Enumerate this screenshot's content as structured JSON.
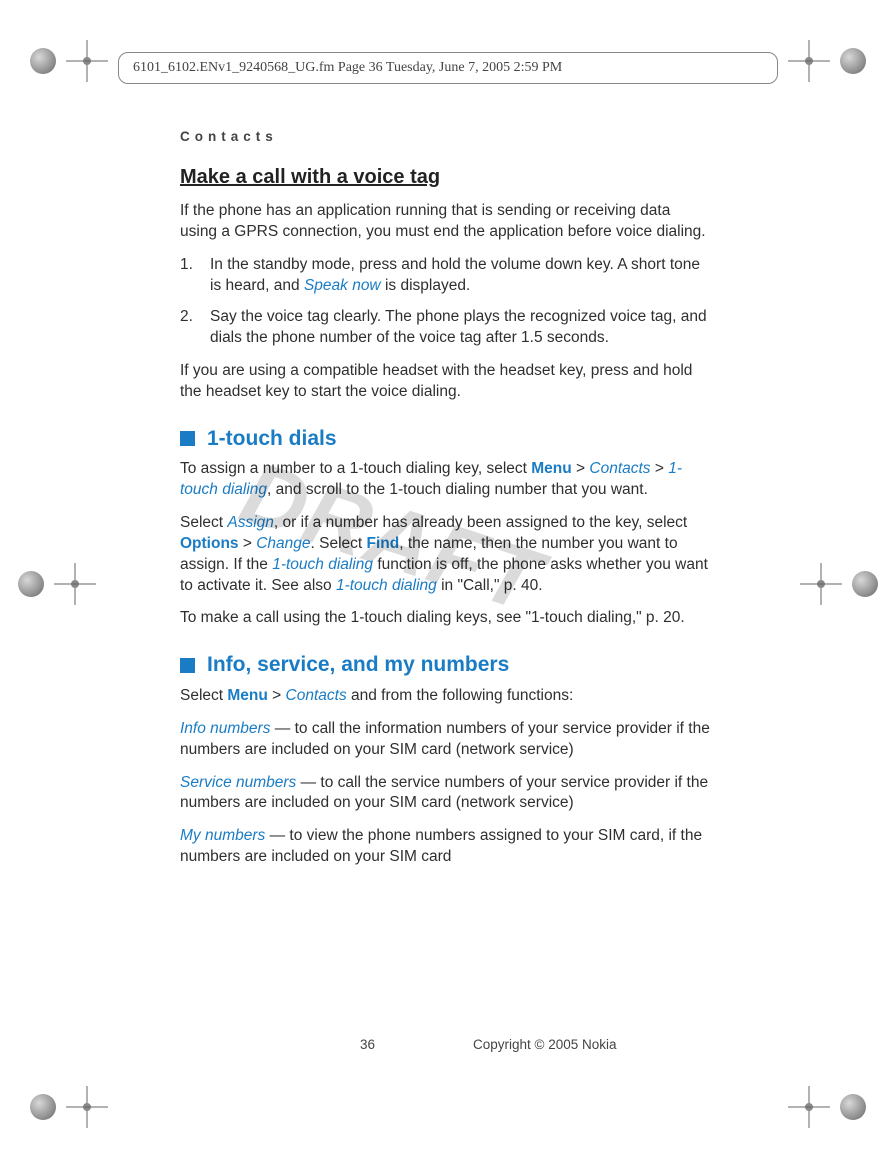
{
  "header_info": "6101_6102.ENv1_9240568_UG.fm  Page 36  Tuesday, June 7, 2005  2:59 PM",
  "running_head": "Contacts",
  "watermark": "DRAFT",
  "h3_voice_tag": "Make a call with a voice tag",
  "p_voice_intro": "If the phone has an application running that is sending or receiving data using a GPRS connection, you must end the application before voice dialing.",
  "li1_num": "1.",
  "li1_a": "In the standby mode, press and hold the volume down key. A short tone is heard, and ",
  "li1_speak": "Speak now",
  "li1_b": " is displayed.",
  "li2_num": "2.",
  "li2_txt": "Say the voice tag clearly. The phone plays the recognized voice tag, and dials the phone number of the voice tag after 1.5 seconds.",
  "p_headset": "If you are using a compatible headset with the headset key, press and hold the headset key to start the voice dialing.",
  "h2_1touch": "1-touch dials",
  "p_1t_a": "To assign a number to a 1-touch dialing key, select ",
  "menu": "Menu",
  "gt": " > ",
  "contacts": "Contacts",
  "onetouch_dialing": "1-touch dialing",
  "p_1t_b": ", and scroll to the 1-touch dialing number that you want.",
  "p_assign_a": "Select ",
  "assign": "Assign",
  "p_assign_b": ", or if a number has already been assigned to the key, select ",
  "options": "Options",
  "change": "Change",
  "p_assign_c": ". Select ",
  "find": "Find",
  "p_assign_d": ", the name, then the number you want to assign. If the ",
  "p_assign_e": " function is off, the phone asks whether you want to activate it. See also ",
  "p_assign_f": " in \"Call,\" p. 40.",
  "p_call_1t": "To make a call using the 1-touch dialing keys, see \"1-touch dialing,\" p. 20.",
  "h2_info": "Info, service, and my numbers",
  "p_info_a": "Select ",
  "p_info_b": " and from the following functions:",
  "info_numbers": "Info numbers",
  "p_infonum": " — to call the information numbers of your service provider if the numbers are included on your SIM card (network service)",
  "service_numbers": "Service numbers",
  "p_svcnum": " — to call the service numbers of your service provider if the numbers are included on your SIM card (network service)",
  "my_numbers": "My numbers",
  "p_mynum": " — to view the phone numbers assigned to your SIM card, if the numbers are included on your SIM card",
  "footer_page": "36",
  "footer_copy": "Copyright © 2005 Nokia"
}
